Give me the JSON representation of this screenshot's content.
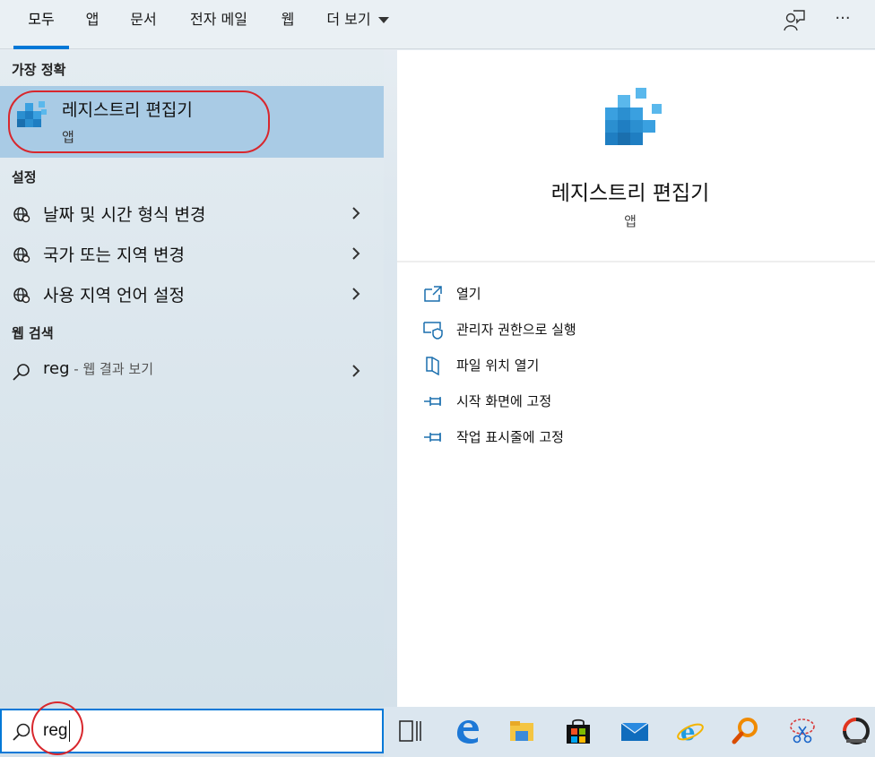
{
  "tabs": [
    {
      "label": "모두",
      "active": true
    },
    {
      "label": "앱"
    },
    {
      "label": "문서"
    },
    {
      "label": "전자 메일"
    },
    {
      "label": "웹"
    },
    {
      "label": "더 보기"
    }
  ],
  "top_icons": [
    "feedback-icon",
    "more-icon"
  ],
  "more_label": "···",
  "left": {
    "best_match_header": "가장 정확",
    "best_match": {
      "title": "레지스트리 편집기",
      "subtitle": "앱",
      "icon": "registry-editor-icon"
    },
    "settings_header": "설정",
    "settings_items": [
      {
        "label": "날짜 및 시간 형식 변경",
        "icon": "globe-settings-icon"
      },
      {
        "label": "국가 또는 지역 변경",
        "icon": "globe-settings-icon"
      },
      {
        "label": "사용 지역 언어 설정",
        "icon": "globe-settings-icon"
      }
    ],
    "web_header": "웹 검색",
    "web_item": {
      "query": "reg",
      "suffix": " - 웹 결과 보기",
      "icon": "search-icon"
    }
  },
  "right": {
    "app_title": "레지스트리 편집기",
    "app_subtitle": "앱",
    "actions": [
      {
        "label": "열기",
        "icon": "open-icon"
      },
      {
        "label": "관리자 권한으로 실행",
        "icon": "admin-shield-icon"
      },
      {
        "label": "파일 위치 열기",
        "icon": "file-location-icon"
      },
      {
        "label": "시작 화면에 고정",
        "icon": "pin-icon"
      },
      {
        "label": "작업 표시줄에 고정",
        "icon": "pin-icon"
      }
    ]
  },
  "search": {
    "value": "reg",
    "icon": "search-icon"
  },
  "taskbar_icons": [
    "task-view-icon",
    "edge-icon",
    "file-explorer-icon",
    "store-icon",
    "mail-icon",
    "internet-explorer-icon",
    "search-app-icon",
    "snipping-tool-icon",
    "app-icon"
  ],
  "colors": {
    "accent": "#0078d7",
    "highlight": "#a9cbe5",
    "annotation_ring": "#d8272d"
  }
}
